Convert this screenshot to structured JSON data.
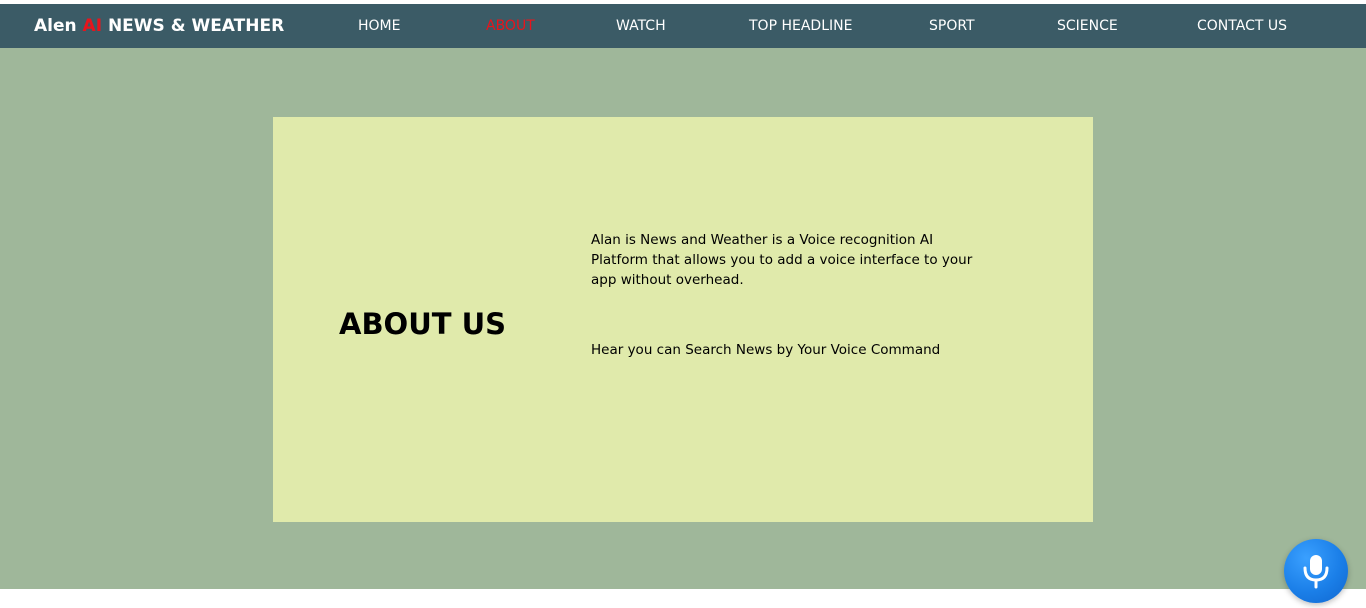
{
  "brand": {
    "part1": "Alen ",
    "ai": "AI",
    "part2": " NEWS & WEATHER"
  },
  "nav": {
    "items": [
      {
        "label": "HOME",
        "active": false
      },
      {
        "label": "ABOUT",
        "active": true
      },
      {
        "label": "WATCH",
        "active": false
      },
      {
        "label": "TOP HEADLINE",
        "active": false
      },
      {
        "label": "SPORT",
        "active": false
      },
      {
        "label": "SCIENCE",
        "active": false
      },
      {
        "label": "CONTACT US",
        "active": false
      }
    ]
  },
  "about": {
    "title": "ABOUT US",
    "paragraph1": "Alan is News and Weather is a Voice recognition AI Platform that allows you to add a voice interface to your app without overhead.",
    "paragraph2": "Hear you can Search News by Your Voice Command"
  },
  "voice_button": {
    "icon": "microphone-icon"
  },
  "colors": {
    "navbar": "#3b5b66",
    "accent_red": "#e8141c",
    "page_background": "#9fb79a",
    "card_background": "#e0eaab",
    "mic_button": "#1b7fe8"
  }
}
